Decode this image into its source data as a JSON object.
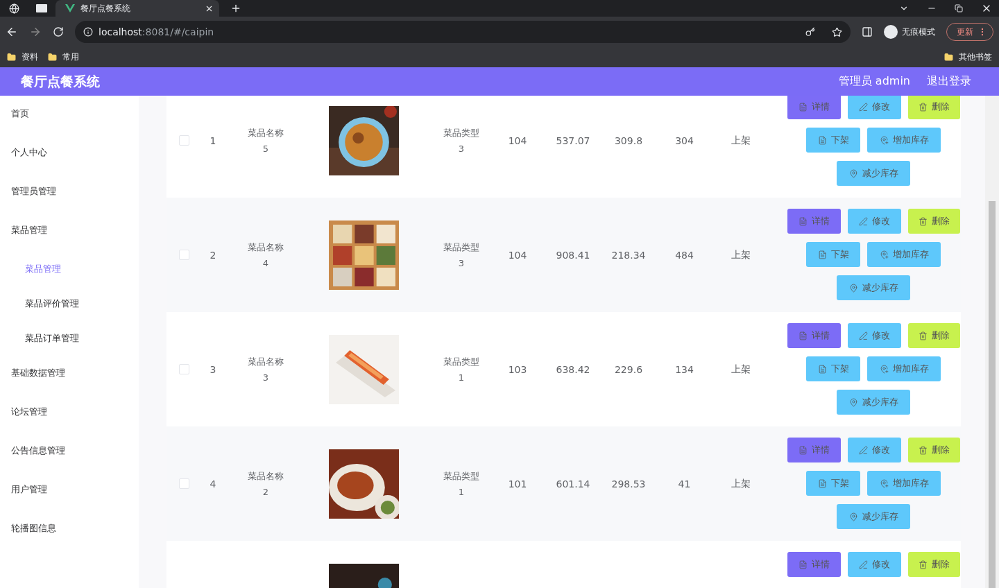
{
  "browser": {
    "tabs": [
      {
        "title": "餐厅点餐系统",
        "selected": true
      }
    ],
    "url_host": "localhost",
    "url_rest": ":8081/#/caipin",
    "incognito_label": "无痕模式",
    "update_button": "更新",
    "bookmarks": [
      "资料",
      "常用"
    ],
    "other_bookmarks": "其他书签"
  },
  "header": {
    "title": "餐厅点餐系统",
    "user": "管理员 admin",
    "logout": "退出登录"
  },
  "sidebar": {
    "items": [
      {
        "label": "首页",
        "selected": false
      },
      {
        "label": "个人中心",
        "selected": false
      },
      {
        "label": "管理员管理",
        "selected": false
      },
      {
        "label": "菜品管理",
        "selected": false,
        "children": [
          {
            "label": "菜品管理",
            "selected": true
          },
          {
            "label": "菜品评价管理",
            "selected": false
          },
          {
            "label": "菜品订单管理",
            "selected": false
          }
        ]
      },
      {
        "label": "基础数据管理",
        "selected": false
      },
      {
        "label": "论坛管理",
        "selected": false
      },
      {
        "label": "公告信息管理",
        "selected": false
      },
      {
        "label": "用户管理",
        "selected": false
      },
      {
        "label": "轮播图信息",
        "selected": false
      }
    ]
  },
  "table": {
    "rows": [
      {
        "checked": false,
        "index": "1",
        "name_label": "菜品名称",
        "name_value": "5",
        "type_label": "菜品类型",
        "type_value": "3",
        "column_7": "104",
        "price": "537.07",
        "column_9": "309.8",
        "stock": "304",
        "status": "上架",
        "actions": [
          {
            "kind": "detail",
            "label": "详情"
          },
          {
            "kind": "edit",
            "label": "修改"
          },
          {
            "kind": "delete",
            "label": "删除"
          },
          {
            "kind": "shelf",
            "label": "下架"
          },
          {
            "kind": "add-stock",
            "label": "增加库存"
          },
          {
            "kind": "reduce-stock",
            "label": "减少库存"
          }
        ]
      },
      {
        "checked": false,
        "index": "2",
        "name_label": "菜品名称",
        "name_value": "4",
        "type_label": "菜品类型",
        "type_value": "3",
        "column_7": "104",
        "price": "908.41",
        "column_9": "218.34",
        "stock": "484",
        "status": "上架",
        "actions": [
          {
            "kind": "detail",
            "label": "详情"
          },
          {
            "kind": "edit",
            "label": "修改"
          },
          {
            "kind": "delete",
            "label": "删除"
          },
          {
            "kind": "shelf",
            "label": "下架"
          },
          {
            "kind": "add-stock",
            "label": "增加库存"
          },
          {
            "kind": "reduce-stock",
            "label": "减少库存"
          }
        ]
      },
      {
        "checked": false,
        "index": "3",
        "name_label": "菜品名称",
        "name_value": "3",
        "type_label": "菜品类型",
        "type_value": "1",
        "column_7": "103",
        "price": "638.42",
        "column_9": "229.6",
        "stock": "134",
        "status": "上架",
        "actions": [
          {
            "kind": "detail",
            "label": "详情"
          },
          {
            "kind": "edit",
            "label": "修改"
          },
          {
            "kind": "delete",
            "label": "删除"
          },
          {
            "kind": "shelf",
            "label": "下架"
          },
          {
            "kind": "add-stock",
            "label": "增加库存"
          },
          {
            "kind": "reduce-stock",
            "label": "减少库存"
          }
        ]
      },
      {
        "checked": false,
        "index": "4",
        "name_label": "菜品名称",
        "name_value": "2",
        "type_label": "菜品类型",
        "type_value": "1",
        "column_7": "101",
        "price": "601.14",
        "column_9": "298.53",
        "stock": "41",
        "status": "上架",
        "actions": [
          {
            "kind": "detail",
            "label": "详情"
          },
          {
            "kind": "edit",
            "label": "修改"
          },
          {
            "kind": "delete",
            "label": "删除"
          },
          {
            "kind": "shelf",
            "label": "下架"
          },
          {
            "kind": "add-stock",
            "label": "增加库存"
          },
          {
            "kind": "reduce-stock",
            "label": "减少库存"
          }
        ]
      },
      {
        "actions": [
          {
            "kind": "detail",
            "label": "详情"
          },
          {
            "kind": "edit",
            "label": "修改"
          },
          {
            "kind": "delete",
            "label": "删除"
          }
        ]
      }
    ]
  }
}
